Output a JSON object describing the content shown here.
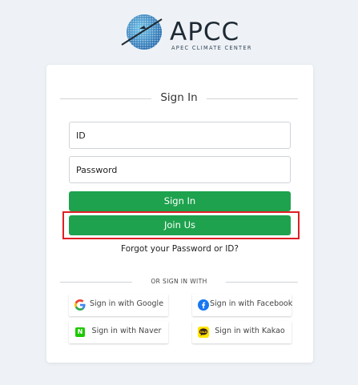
{
  "logo": {
    "name": "APCC",
    "subtitle": "APEC CLIMATE CENTER"
  },
  "signin": {
    "title": "Sign In",
    "id_placeholder": "ID",
    "password_placeholder": "Password",
    "signin_button": "Sign In",
    "join_button": "Join Us",
    "forgot_link": "Forgot your Password or ID?",
    "or_label": "OR SIGN IN WITH"
  },
  "social": {
    "google": {
      "label": "Sign in with Google",
      "icon": "google-icon"
    },
    "facebook": {
      "label": "Sign in with Facebook",
      "icon": "facebook-icon"
    },
    "naver": {
      "label": "Sign in with Naver",
      "icon": "naver-icon",
      "glyph": "N"
    },
    "kakao": {
      "label": "Sign in with Kakao",
      "icon": "kakao-icon",
      "glyph": "TALK"
    }
  },
  "colors": {
    "background": "#eef2f6",
    "button_green": "#1ea24d",
    "highlight_red": "#e01e24",
    "naver_green": "#1ec800",
    "kakao_yellow": "#fee500",
    "facebook_blue": "#1877f2"
  }
}
